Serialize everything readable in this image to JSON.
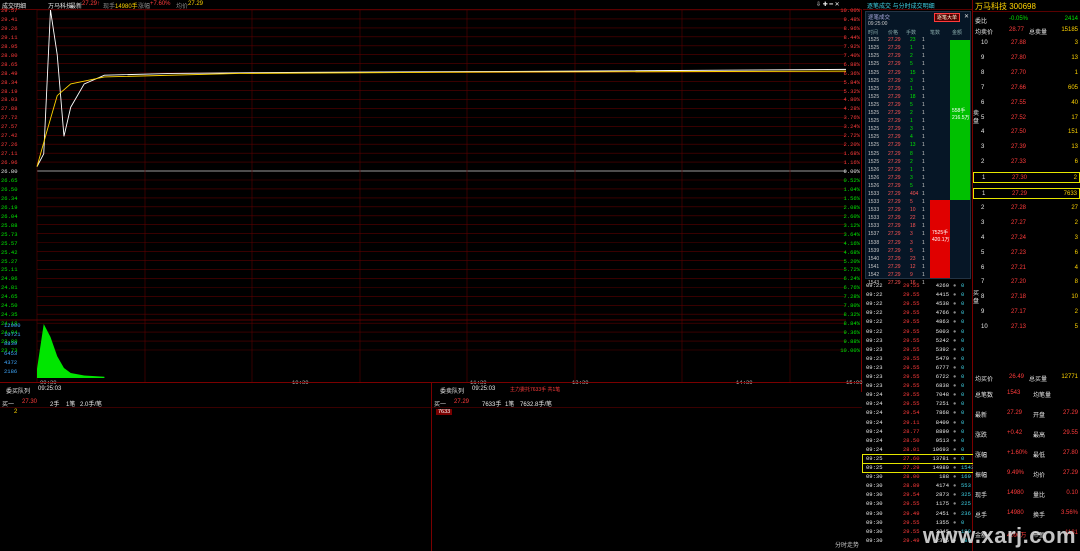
{
  "header": {
    "title": "成交明细",
    "stock_label": "万马科技",
    "last_price_label": "最新",
    "last_price": "27.29",
    "arrow": "↑",
    "vol_label": "现手",
    "vol_value": "14980手",
    "change_label": "涨幅",
    "change_value": "+7.60%",
    "avg_label": "均价",
    "avg_value": "27.29",
    "toolbar": "⇩ ✚ ━ ✕"
  },
  "chart": {
    "prices": [
      "29.57",
      "29.41",
      "29.26",
      "29.11",
      "28.95",
      "28.80",
      "28.65",
      "28.49",
      "28.34",
      "28.19",
      "28.03",
      "27.88",
      "27.72",
      "27.57",
      "27.42",
      "27.26",
      "27.11",
      "26.96",
      "26.80",
      "26.65",
      "26.50",
      "26.34",
      "26.19",
      "26.04",
      "25.88",
      "25.73",
      "25.57",
      "25.42",
      "25.27",
      "25.11",
      "24.96",
      "24.81",
      "24.65",
      "24.50",
      "24.35",
      "24.19",
      "24.04",
      "23.89",
      "23.73"
    ],
    "pcts": [
      "10.00%",
      "9.48%",
      "8.96%",
      "8.44%",
      "7.92%",
      "7.40%",
      "6.88%",
      "6.36%",
      "5.84%",
      "5.32%",
      "4.80%",
      "4.28%",
      "3.76%",
      "3.24%",
      "2.72%",
      "2.20%",
      "1.68%",
      "1.16%",
      "0.00%",
      "0.52%",
      "1.04%",
      "1.56%",
      "2.08%",
      "2.60%",
      "3.12%",
      "3.64%",
      "4.16%",
      "4.68%",
      "5.20%",
      "5.72%",
      "6.24%",
      "6.76%",
      "7.28%",
      "7.80%",
      "8.32%",
      "8.84%",
      "9.36%",
      "9.88%",
      "10.00%"
    ],
    "vol_ticks": [
      "12900",
      "10721",
      "8839",
      "6453",
      "4372",
      "2186"
    ],
    "times": [
      "09:30",
      "10:30",
      "11:30",
      "13:30",
      "14:30",
      "15:00"
    ],
    "colors": {
      "grid": "#5a0000",
      "price_line": "#ffffff",
      "avg_line": "#ffd400",
      "volume": "#00e600",
      "zero_line": "#9a9a9a"
    },
    "chart_data": {
      "type": "line",
      "title": "",
      "xlabel": "",
      "ylabel": "",
      "ylim": [
        23.73,
        29.57
      ],
      "series": [
        {
          "name": "",
          "x": [
            0,
            2,
            4,
            6,
            8,
            10,
            14,
            20,
            40,
            80,
            160,
            240
          ],
          "values": [
            26.88,
            27.1,
            29.57,
            28.8,
            27.4,
            27.9,
            28.3,
            28.45,
            28.48,
            28.5,
            28.52,
            28.55
          ]
        },
        {
          "name": "",
          "x": [
            0,
            3,
            6,
            10,
            20,
            60,
            120,
            240
          ],
          "values": [
            26.88,
            27.5,
            28.1,
            28.3,
            28.42,
            28.48,
            28.5,
            28.52
          ]
        }
      ],
      "volume": {
        "x": [
          0,
          2,
          4,
          6,
          8,
          10,
          14,
          20
        ],
        "values": [
          2186,
          12900,
          9800,
          5200,
          2400,
          1200,
          600,
          300
        ]
      }
    }
  },
  "buy_queue": {
    "title": "委买队列",
    "time": "09:25:03",
    "side_label": "买一",
    "price": "27.30",
    "hands": "2手",
    "count": "1笔",
    "per": "2.0手/笔",
    "entry": "2"
  },
  "sell_queue": {
    "title": "委卖队列",
    "time": "09:25:03",
    "note": "主力委托7633手 共1笔",
    "side_label": "买一",
    "price": "27.29",
    "hands": "7633手",
    "count": "1笔",
    "per": "7632.8手/笔",
    "entry": "7633"
  },
  "ticks": {
    "top_title": "逐笔成交 与分时成交明细",
    "sub_title": "逐笔成交",
    "sub_btn": "逐笔大单",
    "sub_time": "09:25:00",
    "sub_cols": [
      "时间",
      "价格",
      "手数",
      "笔数",
      "金额"
    ],
    "sub_rows": [
      [
        "1525",
        "27.29",
        "23",
        "1",
        "卖"
      ],
      [
        "1525",
        "27.29",
        "1",
        "1",
        "卖"
      ],
      [
        "1525",
        "27.29",
        "2",
        "1",
        "卖"
      ],
      [
        "1525",
        "27.29",
        "5",
        "1",
        "卖"
      ],
      [
        "1525",
        "27.29",
        "15",
        "1",
        "卖"
      ],
      [
        "1525",
        "27.29",
        "3",
        "1",
        "卖"
      ],
      [
        "1525",
        "27.29",
        "1",
        "1",
        "卖"
      ],
      [
        "1525",
        "27.29",
        "18",
        "1",
        "卖"
      ],
      [
        "1525",
        "27.29",
        "5",
        "1",
        "卖"
      ],
      [
        "1525",
        "27.29",
        "2",
        "1",
        "卖"
      ],
      [
        "1525",
        "27.29",
        "1",
        "1",
        "卖"
      ],
      [
        "1525",
        "27.29",
        "3",
        "1",
        "卖"
      ],
      [
        "1525",
        "27.29",
        "4",
        "1",
        "卖"
      ],
      [
        "1525",
        "27.29",
        "13",
        "1",
        "卖"
      ],
      [
        "1525",
        "27.29",
        "8",
        "1",
        "卖"
      ],
      [
        "1525",
        "27.29",
        "2",
        "1",
        "卖"
      ],
      [
        "1526",
        "27.29",
        "1",
        "1",
        "卖"
      ],
      [
        "1526",
        "27.29",
        "3",
        "1",
        "卖"
      ],
      [
        "1526",
        "27.29",
        "5",
        "1",
        "卖"
      ],
      [
        "1533",
        "27.29",
        "404",
        "1",
        "买"
      ],
      [
        "1533",
        "27.29",
        "5",
        "1",
        "买"
      ],
      [
        "1533",
        "27.29",
        "10",
        "1",
        "买"
      ],
      [
        "1533",
        "27.29",
        "22",
        "1",
        "买"
      ],
      [
        "1533",
        "27.29",
        "18",
        "1",
        "买"
      ],
      [
        "1537",
        "27.29",
        "3",
        "1",
        "买"
      ],
      [
        "1538",
        "27.29",
        "3",
        "1",
        "买"
      ],
      [
        "1539",
        "27.29",
        "5",
        "1",
        "买"
      ],
      [
        "1540",
        "27.29",
        "23",
        "1",
        "买"
      ],
      [
        "1541",
        "27.29",
        "12",
        "1",
        "买"
      ],
      [
        "1542",
        "27.29",
        "9",
        "1",
        "买"
      ],
      [
        "1543",
        "27.29",
        "16",
        "1",
        "买"
      ]
    ],
    "green_label": "558手\n216.5万",
    "red_label": "7525手\n420.1万",
    "rows": [
      [
        "09:22",
        "29.55",
        "4260",
        "0"
      ],
      [
        "09:22",
        "29.55",
        "4415",
        "0"
      ],
      [
        "09:22",
        "29.55",
        "4538",
        "0"
      ],
      [
        "09:22",
        "29.55",
        "4766",
        "0"
      ],
      [
        "09:22",
        "29.55",
        "4863",
        "0"
      ],
      [
        "09:22",
        "29.55",
        "5003",
        "0"
      ],
      [
        "09:23",
        "29.55",
        "5242",
        "0"
      ],
      [
        "09:23",
        "29.55",
        "5392",
        "0"
      ],
      [
        "09:23",
        "29.55",
        "5479",
        "0"
      ],
      [
        "09:23",
        "29.55",
        "6777",
        "0"
      ],
      [
        "09:23",
        "29.55",
        "6722",
        "0"
      ],
      [
        "09:23",
        "29.55",
        "6838",
        "0"
      ],
      [
        "09:24",
        "29.55",
        "7048",
        "0"
      ],
      [
        "09:24",
        "29.55",
        "7251",
        "0"
      ],
      [
        "09:24",
        "29.54",
        "7868",
        "0"
      ],
      [
        "09:24",
        "29.11",
        "8409",
        "0"
      ],
      [
        "09:24",
        "28.77",
        "8890",
        "0"
      ],
      [
        "09:24",
        "28.50",
        "9513",
        "0"
      ],
      [
        "09:24",
        "28.01",
        "10693",
        "0"
      ],
      [
        "09:25",
        "27.60",
        "13781",
        "0"
      ],
      [
        "09:25",
        "27.29",
        "14980",
        "1543"
      ],
      [
        "09:30",
        "28.00",
        "188",
        "169"
      ],
      [
        "09:30",
        "28.89",
        "4174",
        "553"
      ],
      [
        "09:30",
        "29.54",
        "2873",
        "325"
      ],
      [
        "09:30",
        "29.55",
        "1175",
        "225"
      ],
      [
        "09:30",
        "29.49",
        "2451",
        "236"
      ],
      [
        "09:30",
        "29.55",
        "1355",
        "0"
      ],
      [
        "09:30",
        "29.55",
        "3245",
        "189"
      ],
      [
        "09:30",
        "29.49",
        "2375",
        "189"
      ]
    ],
    "chart_name": "分时走势"
  },
  "book": {
    "title": "万马科技 300698",
    "ratio_label": "委比",
    "ratio_value": "-0.05%",
    "ratio_diff": "2414",
    "sell_avg_label": "均卖价",
    "sell_avg": "28.77",
    "sell_total_label": "总卖量",
    "sell_total": "15185",
    "asks": [
      [
        "10",
        "27.88",
        "3"
      ],
      [
        "9",
        "27.80",
        "13"
      ],
      [
        "8",
        "27.70",
        "1"
      ],
      [
        "7",
        "27.66",
        "605"
      ],
      [
        "6",
        "27.55",
        "40"
      ],
      [
        "5",
        "27.52",
        "17"
      ],
      [
        "4",
        "27.50",
        "151"
      ],
      [
        "3",
        "27.39",
        "13"
      ],
      [
        "2",
        "27.33",
        "6"
      ],
      [
        "1",
        "27.30",
        "2"
      ]
    ],
    "bids": [
      [
        "1",
        "27.29",
        "7633"
      ],
      [
        "2",
        "27.28",
        "27"
      ],
      [
        "3",
        "27.27",
        "2"
      ],
      [
        "4",
        "27.24",
        "3"
      ],
      [
        "5",
        "27.23",
        "6"
      ],
      [
        "6",
        "27.21",
        "4"
      ],
      [
        "7",
        "27.20",
        "8"
      ],
      [
        "8",
        "27.18",
        "10"
      ],
      [
        "9",
        "27.17",
        "2"
      ],
      [
        "10",
        "27.13",
        "5"
      ]
    ],
    "side_sell": "卖盘",
    "side_buy": "买盘",
    "buy_avg_label": "均买价",
    "buy_avg": "26.49",
    "buy_total_label": "总买量",
    "buy_total": "12771",
    "stats": [
      [
        "总笔数",
        "1543",
        "均笔量",
        ""
      ],
      [
        "最新",
        "27.29",
        "开盘",
        "27.29"
      ],
      [
        "涨跌",
        "+0.42",
        "最高",
        "29.55"
      ],
      [
        "涨幅",
        "+1.60%",
        "最低",
        "27.80"
      ],
      [
        "振幅",
        "9.49%",
        "均价",
        "27.29"
      ],
      [
        "现手",
        "14980",
        "量比",
        "0.10"
      ],
      [
        "总手",
        "14980",
        "换手",
        "3.56%"
      ],
      [
        "金额",
        "4090万",
        "市盈",
        "1181"
      ]
    ],
    "watermark": "www.xarj.com"
  }
}
